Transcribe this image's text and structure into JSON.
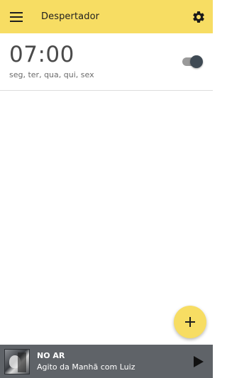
{
  "header": {
    "title": "Despertador",
    "menu_icon": "menu-icon",
    "settings_icon": "gear-icon",
    "background": "#f7dd63"
  },
  "alarm": {
    "time": "07:00",
    "days": "seg, ter, qua, qui, sex",
    "enabled": true
  },
  "fab": {
    "icon": "plus-icon"
  },
  "player": {
    "status": "NO AR",
    "program": "Agito da Manhã com Luiz",
    "play_icon": "play-icon"
  }
}
